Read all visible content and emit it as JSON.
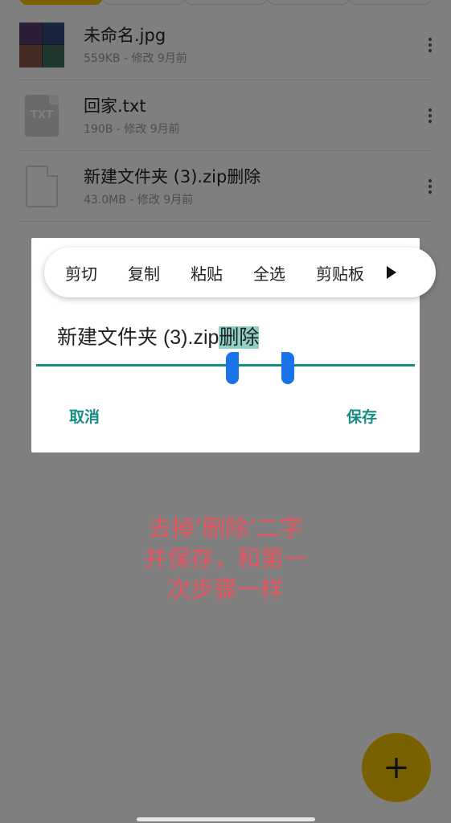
{
  "files": [
    {
      "name": "未命名.jpg",
      "meta": "559KB - 修改 9月前",
      "thumb": "image-thumbnail"
    },
    {
      "name": "回家.txt",
      "meta": "190B - 修改 9月前",
      "thumb": "txt-file-icon",
      "thumb_label": "TXT"
    },
    {
      "name": "新建文件夹 (3).zip删除",
      "meta": "43.0MB - 修改 9月前",
      "thumb": "blank-file-icon"
    }
  ],
  "toolbar": {
    "items": [
      "剪切",
      "复制",
      "粘贴",
      "全选",
      "剪贴板"
    ]
  },
  "dialog": {
    "text_before": "新建文件夹 (3).zip",
    "text_selected": "删除",
    "cancel_label": "取消",
    "save_label": "保存"
  },
  "annotation": {
    "lines": [
      "去掉‘删除’二字",
      "并保存，和第一",
      "次步骤一样"
    ]
  },
  "fab": {
    "label": "+"
  },
  "colors": {
    "accent": "#f2c200",
    "dialog_teal": "#178c84",
    "selection_handle": "#1a73e8",
    "annotation": "#e8555e"
  }
}
